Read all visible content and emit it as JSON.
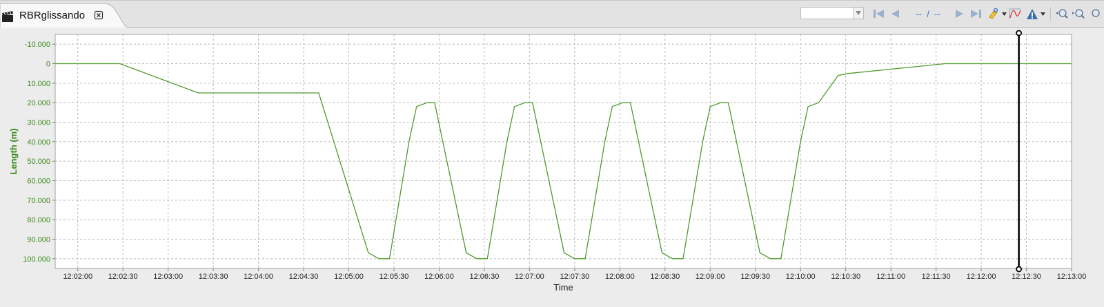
{
  "tab": {
    "title": "RBRglissando"
  },
  "toolbar": {
    "nav_first": "--",
    "nav_sep": "/",
    "nav_last": "--",
    "icons": [
      "combo-dropdown",
      "first-icon",
      "previous-icon",
      "next-icon",
      "last-icon",
      "marker-icon",
      "dropdown-arrow",
      "curve-icon",
      "warning-icon",
      "dropdown-arrow",
      "zoom-in-icon",
      "zoom-out-icon",
      "zoom-reset-icon"
    ]
  },
  "colors": {
    "series": "#4c9a2a",
    "axis_label": "#3a8a1a",
    "cursor": "#000000"
  },
  "chart_data": {
    "type": "line",
    "xlabel": "Time",
    "ylabel": "Length (m)",
    "y_inverted": true,
    "ylim": [
      -15000,
      105000
    ],
    "xlim": [
      "12:01:45",
      "12:13:00"
    ],
    "x_ticks": [
      "12:02:00",
      "12:02:30",
      "12:03:00",
      "12:03:30",
      "12:04:00",
      "12:04:30",
      "12:05:00",
      "12:05:30",
      "12:06:00",
      "12:06:30",
      "12:07:00",
      "12:07:30",
      "12:08:00",
      "12:08:30",
      "12:09:00",
      "12:09:30",
      "12:10:00",
      "12:10:30",
      "12:11:00",
      "12:11:30",
      "12:12:00",
      "12:12:30",
      "12:13:00"
    ],
    "y_ticks": [
      "-10.000",
      "0",
      "10.000",
      "20.000",
      "30.000",
      "40.000",
      "50.000",
      "60.000",
      "70.000",
      "80.000",
      "90.000",
      "100.000"
    ],
    "grid": true,
    "cursor_time": "12:12:25",
    "series": [
      {
        "values": [
          [
            "12:01:45",
            0
          ],
          [
            "12:02:28",
            0
          ],
          [
            "12:03:20",
            15000
          ],
          [
            "12:04:40",
            15000
          ],
          [
            "12:05:13",
            97000
          ],
          [
            "12:05:20",
            100000
          ],
          [
            "12:05:27",
            100000
          ],
          [
            "12:05:40",
            40000
          ],
          [
            "12:05:45",
            22000
          ],
          [
            "12:05:52",
            20000
          ],
          [
            "12:05:57",
            20000
          ],
          [
            "12:06:18",
            97000
          ],
          [
            "12:06:25",
            100000
          ],
          [
            "12:06:32",
            100000
          ],
          [
            "12:06:45",
            40000
          ],
          [
            "12:06:50",
            22000
          ],
          [
            "12:06:57",
            20000
          ],
          [
            "12:07:02",
            20000
          ],
          [
            "12:07:23",
            97000
          ],
          [
            "12:07:30",
            100000
          ],
          [
            "12:07:37",
            100000
          ],
          [
            "12:07:50",
            40000
          ],
          [
            "12:07:55",
            22000
          ],
          [
            "12:08:02",
            20000
          ],
          [
            "12:08:07",
            20000
          ],
          [
            "12:08:28",
            97000
          ],
          [
            "12:08:35",
            100000
          ],
          [
            "12:08:42",
            100000
          ],
          [
            "12:08:55",
            40000
          ],
          [
            "12:09:00",
            22000
          ],
          [
            "12:09:07",
            20000
          ],
          [
            "12:09:12",
            20000
          ],
          [
            "12:09:33",
            97000
          ],
          [
            "12:09:40",
            100000
          ],
          [
            "12:09:47",
            100000
          ],
          [
            "12:10:00",
            40000
          ],
          [
            "12:10:05",
            22000
          ],
          [
            "12:10:12",
            20000
          ],
          [
            "12:10:25",
            6000
          ],
          [
            "12:10:32",
            5000
          ],
          [
            "12:11:36",
            0
          ],
          [
            "12:13:00",
            0
          ]
        ]
      }
    ]
  }
}
